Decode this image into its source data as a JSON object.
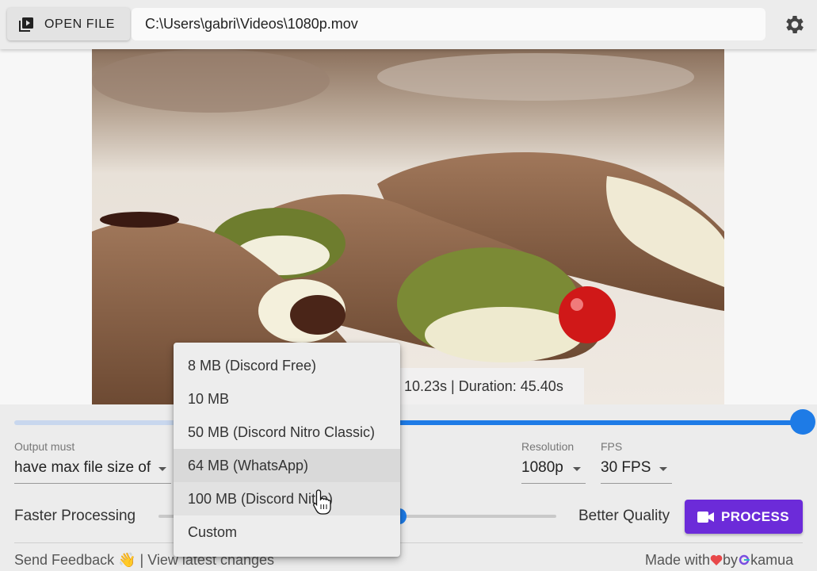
{
  "toolbar": {
    "open_file_label": "OPEN FILE",
    "file_path": "C:\\Users\\gabri\\Videos\\1080p.mov",
    "settings_icon": "gear-icon"
  },
  "preview": {
    "time_info_visible": "n 10.23s | Duration: 45.40s"
  },
  "trim": {
    "start_fraction": 0.47,
    "end_fraction": 1.0
  },
  "output": {
    "label": "Output must",
    "mode_value": "have max file size of"
  },
  "resolution": {
    "label": "Resolution",
    "value": "1080p"
  },
  "fps": {
    "label": "FPS",
    "value": "30 FPS"
  },
  "quality": {
    "left_label": "Faster Processing",
    "right_label": "Better Quality",
    "level_fraction": 0.6
  },
  "process_button": {
    "label": "PROCESS",
    "color": "#6c2bd9"
  },
  "footer": {
    "feedback": "Send Feedback 👋",
    "separator": "|",
    "changes": "View latest changes",
    "made_with": "Made with",
    "by": "by",
    "brand": "kamua"
  },
  "size_menu": {
    "items": [
      "8 MB (Discord Free)",
      "10 MB",
      "50 MB (Discord Nitro Classic)",
      "64 MB (WhatsApp)",
      "100 MB (Discord Nitro)",
      "Custom"
    ],
    "selected_index": 3,
    "hover_index": 4
  },
  "colors": {
    "accent_blue": "#1e7be6",
    "process_purple": "#6c2bd9",
    "heart_red": "#e8484a"
  }
}
